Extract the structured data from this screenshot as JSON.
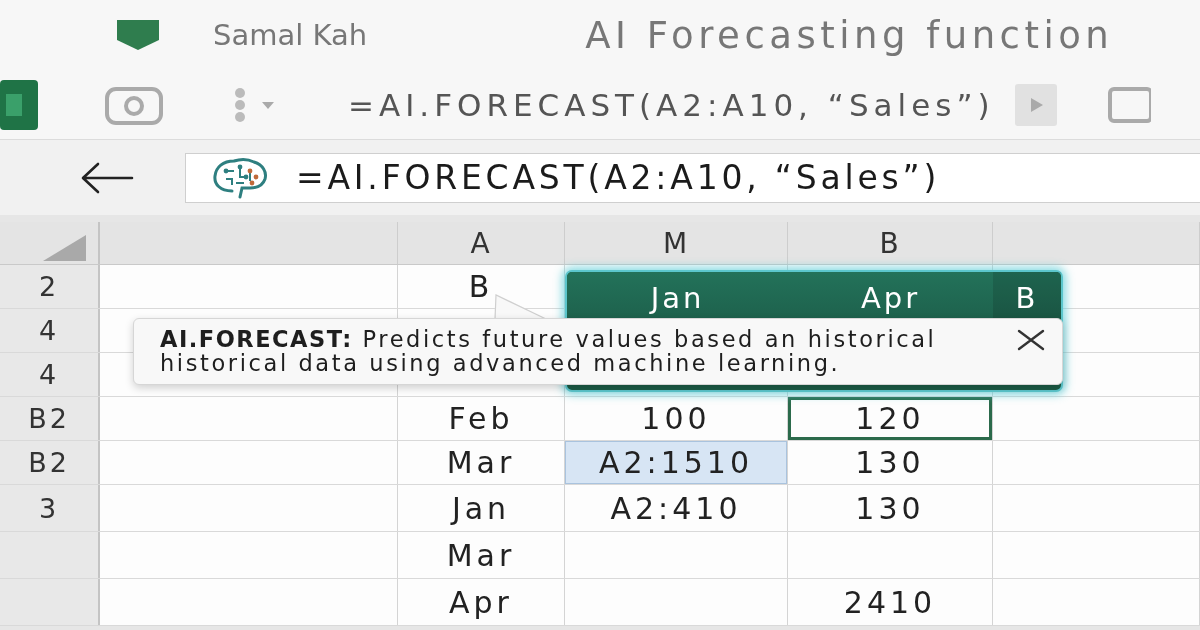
{
  "title_bar": {
    "author": "Samal Kah",
    "title": "AI Forecasting function"
  },
  "toolbar": {
    "formula": "=AI.FORECAST(A2:A10, “Sales”)"
  },
  "formula_bar": {
    "formula": "=AI.FORECAST(A2:A10, “Sales”)"
  },
  "sheet": {
    "columns": [
      {
        "label": "A"
      },
      {
        "label": "M"
      },
      {
        "label": "B"
      }
    ],
    "rows": [
      {
        "header": "2",
        "cells": [
          {
            "text": "B",
            "selected": false,
            "highlighted": false
          }
        ]
      },
      {
        "header": "4"
      },
      {
        "header": "4"
      },
      {
        "header": "B2",
        "cells": [
          {
            "text": "Feb",
            "selected": false,
            "highlighted": false
          },
          {
            "text": "100",
            "selected": false,
            "highlighted": false
          },
          {
            "text": "120",
            "selected": true,
            "highlighted": false
          }
        ]
      },
      {
        "header": "B2",
        "cells": [
          {
            "text": "Mar",
            "selected": false,
            "highlighted": false
          },
          {
            "text": "A2:1510",
            "selected": false,
            "highlighted": true
          },
          {
            "text": "130",
            "selected": false,
            "highlighted": false
          }
        ]
      },
      {
        "header": "3",
        "cells": [
          {
            "text": "Jan",
            "selected": false,
            "highlighted": false
          },
          {
            "text": "A2:410",
            "selected": false,
            "highlighted": false
          },
          {
            "text": "130",
            "selected": false,
            "highlighted": false
          }
        ]
      },
      {
        "cells": [
          {
            "text": "Mar",
            "selected": false,
            "highlighted": false
          },
          {
            "selected": false,
            "highlighted": false
          },
          {
            "selected": false,
            "highlighted": false
          }
        ]
      },
      {
        "cells": [
          {
            "text": "Apr",
            "selected": false,
            "highlighted": false
          },
          {
            "selected": false,
            "highlighted": false
          },
          {
            "text": "2410",
            "selected": false,
            "highlighted": false
          }
        ]
      }
    ]
  },
  "forecast_header": {
    "labels": [
      "Jan",
      "Apr",
      "B"
    ]
  },
  "tooltip": {
    "text": "**AI.FORECAST:** Predicts future values based an historical historical data using advanced machine learning."
  }
}
